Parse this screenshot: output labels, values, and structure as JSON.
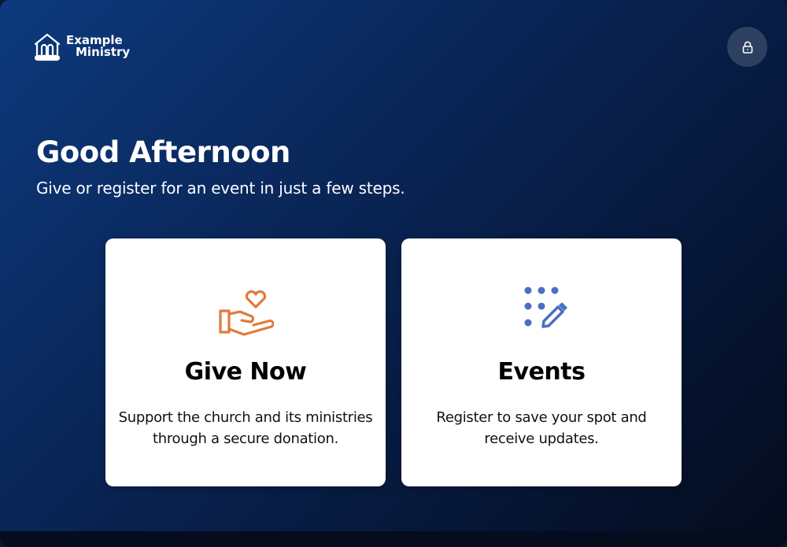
{
  "logo": {
    "line1": "Example",
    "line2": "Ministry",
    "icon": "church-icon"
  },
  "header": {
    "lock_icon": "lock-icon"
  },
  "hero": {
    "greeting": "Good Afternoon",
    "subtitle": "Give or register for an event in just a few steps."
  },
  "cards": [
    {
      "title": "Give Now",
      "description_line1": "Support the church and its ministries",
      "description_line2": "through a secure donation.",
      "icon": "heart-hand-icon",
      "accent": "#e07a3e"
    },
    {
      "title": "Events",
      "description_line1": "Register to save your spot and",
      "description_line2": "receive updates.",
      "icon": "calendar-edit-icon",
      "accent": "#4a6fc4"
    }
  ],
  "colors": {
    "background_start": "#0d3a7e",
    "background_end": "#040b1c",
    "card": "#ffffff"
  }
}
